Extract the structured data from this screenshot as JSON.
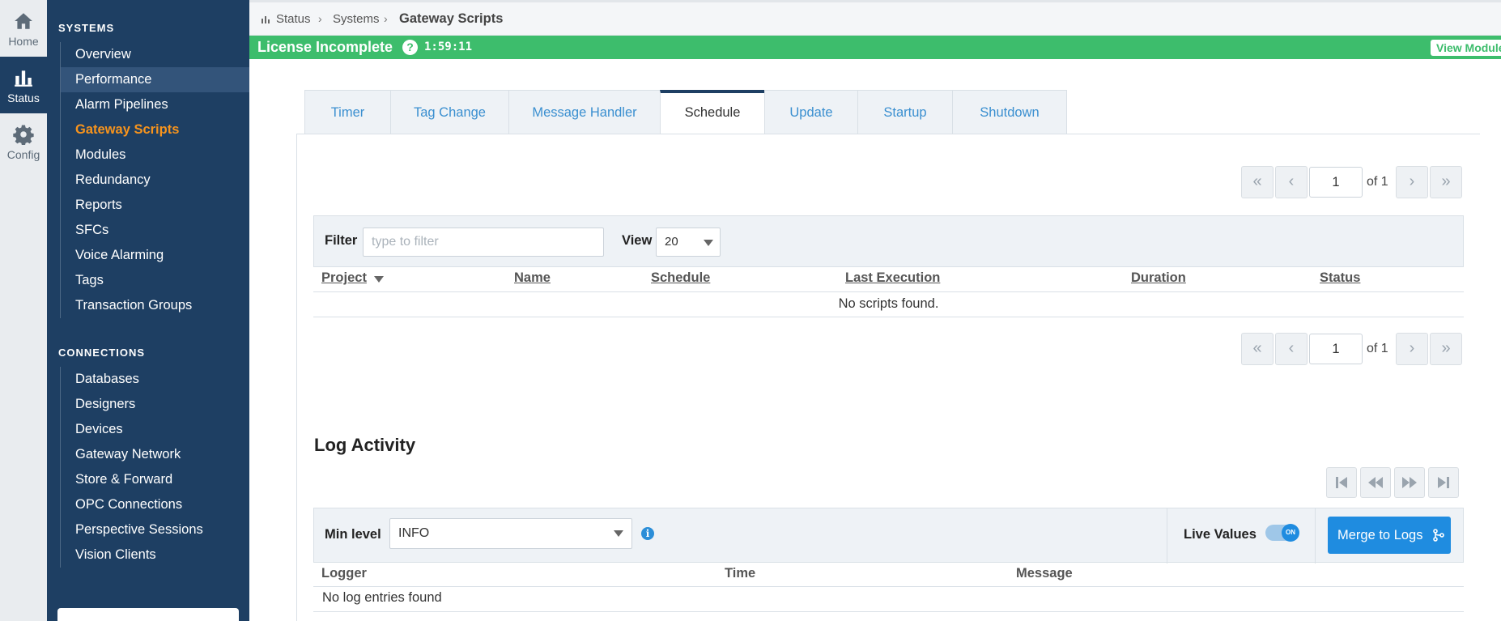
{
  "rail": {
    "home_label": "Home",
    "status_label": "Status",
    "config_label": "Config"
  },
  "sidebar": {
    "systems_title": "SYSTEMS",
    "systems_items": [
      "Overview",
      "Performance",
      "Alarm Pipelines",
      "Gateway Scripts",
      "Modules",
      "Redundancy",
      "Reports",
      "SFCs",
      "Voice Alarming",
      "Tags",
      "Transaction Groups"
    ],
    "connections_title": "CONNECTIONS",
    "connections_items": [
      "Databases",
      "Designers",
      "Devices",
      "Gateway Network",
      "Store & Forward",
      "OPC Connections",
      "Perspective Sessions",
      "Vision Clients"
    ]
  },
  "breadcrumb": {
    "status": "Status",
    "systems": "Systems",
    "current": "Gateway Scripts"
  },
  "license": {
    "title": "License Incomplete",
    "help": "?",
    "timer": "1:59:11",
    "view_modules": "View Modules"
  },
  "tabs": [
    "Timer",
    "Tag Change",
    "Message Handler",
    "Schedule",
    "Update",
    "Startup",
    "Shutdown"
  ],
  "pager": {
    "first": "«",
    "prev": "‹",
    "page": "1",
    "of": "of 1",
    "next": "›",
    "last": "»"
  },
  "filter": {
    "label": "Filter",
    "placeholder": "type to filter",
    "view_label": "View",
    "view_value": "20"
  },
  "table": {
    "columns": [
      "Project",
      "Name",
      "Schedule",
      "Last Execution",
      "Duration",
      "Status"
    ],
    "empty": "No scripts found."
  },
  "log": {
    "title": "Log Activity",
    "min_level_label": "Min level",
    "min_level_value": "INFO",
    "info": "i",
    "live_values_label": "Live Values",
    "toggle_text": "ON",
    "merge_label": "Merge to Logs",
    "columns": [
      "Logger",
      "Time",
      "Message"
    ],
    "empty": "No log entries found"
  },
  "colors": {
    "sidebar_bg": "#1e3f63",
    "license_bg": "#3dbd6c",
    "accent": "#1f8ce0",
    "current_item": "#f7941d"
  }
}
